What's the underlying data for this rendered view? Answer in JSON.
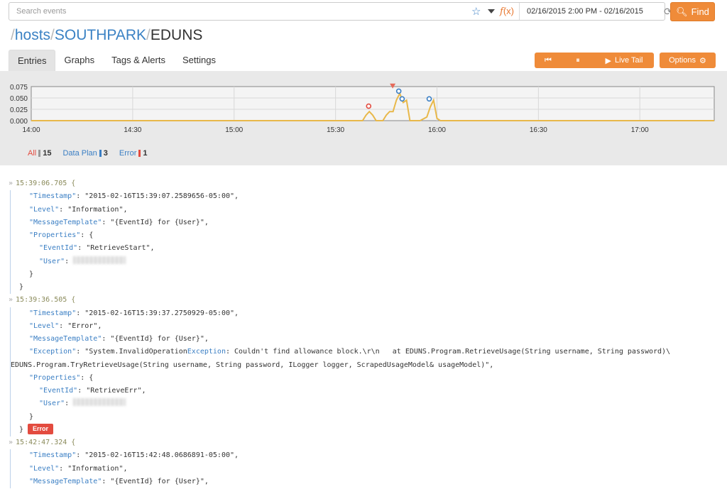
{
  "search": {
    "placeholder": "Search events",
    "date_range": "02/16/2015 2:00 PM - 02/16/2015",
    "fx_label": "f",
    "find_label": "Find"
  },
  "breadcrumb": {
    "host_root": "hosts",
    "group": "SOUTHPARK",
    "current": "EDUNS",
    "separator": "/"
  },
  "tabs": [
    {
      "label": "Entries",
      "active": true
    },
    {
      "label": "Graphs"
    },
    {
      "label": "Tags & Alerts"
    },
    {
      "label": "Settings"
    }
  ],
  "controls": {
    "live_tail": "Live Tail",
    "options": "Options"
  },
  "legend": [
    {
      "label": "All",
      "count": "15",
      "color": "#e34b3f",
      "bar_color": "#999"
    },
    {
      "label": "Data Plan",
      "count": "3",
      "color": "#3b7fc4",
      "bar_color": "#3b7fc4"
    },
    {
      "label": "Error",
      "count": "1",
      "color": "#3b7fc4",
      "bar_color": "#e34b3f"
    }
  ],
  "chart_data": {
    "type": "line",
    "y_ticks": [
      "0.075",
      "0.050",
      "0.025",
      "0.000"
    ],
    "x_ticks": [
      "14:00",
      "14:30",
      "15:00",
      "15:30",
      "16:00",
      "16:30",
      "17:00"
    ],
    "ylim": [
      0,
      0.075
    ],
    "xlim_minutes": [
      0,
      202
    ],
    "grid": true,
    "series_color": "#e8b84a",
    "points": [
      [
        0,
        0
      ],
      [
        98,
        0
      ],
      [
        99,
        0.012
      ],
      [
        100,
        0.02
      ],
      [
        101,
        0.012
      ],
      [
        102,
        0
      ],
      [
        104,
        0
      ],
      [
        105,
        0.012
      ],
      [
        106,
        0.02
      ],
      [
        107,
        0.02
      ],
      [
        108,
        0.045
      ],
      [
        109,
        0.06
      ],
      [
        110,
        0.04
      ],
      [
        111,
        0.045
      ],
      [
        112,
        0.0
      ],
      [
        115,
        0
      ],
      [
        117,
        0.008
      ],
      [
        118,
        0.03
      ],
      [
        119,
        0.045
      ],
      [
        120,
        0.005
      ],
      [
        121,
        0
      ],
      [
        202,
        0
      ]
    ],
    "markers": [
      {
        "x": 99.8,
        "y": 0.032,
        "color": "#e34b3f",
        "shape": "circle"
      },
      {
        "x": 108.7,
        "y": 0.065,
        "color": "#3b7fc4",
        "shape": "circle"
      },
      {
        "x": 109.7,
        "y": 0.048,
        "color": "#3b7fc4",
        "shape": "circle"
      },
      {
        "x": 117.7,
        "y": 0.048,
        "color": "#3b7fc4",
        "shape": "circle"
      },
      {
        "x": 106.9,
        "y": 0.077,
        "color": "#e56a5a",
        "shape": "triangle"
      }
    ]
  },
  "entries": [
    {
      "time": "15:39:06.705 {",
      "timestamp": "\"2015-02-16T15:39:07.2589656-05:00\",",
      "level": "\"Information\",",
      "template": "\"{EventId} for {User}\",",
      "event_id": "\"RetrieveStart\","
    },
    {
      "time": "15:39:36.505 {",
      "timestamp": "\"2015-02-16T15:39:37.2750929-05:00\",",
      "level": "\"Error\",",
      "template": "\"{EventId} for {User}\",",
      "exception_a": "\"System.InvalidOperation",
      "exception_b": "Exception",
      "exception_c": ": Couldn't find allowance block.\\r\\n   at EDUNS.Program.RetrieveUsage(String username, String password)\\",
      "exception_d": "EDUNS.Program.TryRetrieveUsage(String username, String password, ILogger logger, ScrapedUsageModel& usageModel)\",",
      "event_id": "\"RetrieveErr\",",
      "badge": "Error"
    },
    {
      "time": "15:42:47.324 {",
      "timestamp": "\"2015-02-16T15:42:48.0686891-05:00\",",
      "level": "\"Information\",",
      "template": "\"{EventId} for {User}\","
    }
  ],
  "keys": {
    "timestamp": "\"Timestamp\"",
    "level": "\"Level\"",
    "template": "\"MessageTemplate\"",
    "exception": "\"Exception\"",
    "properties": "\"Properties\"",
    "event_id": "\"EventId\"",
    "user": "\"User\""
  }
}
